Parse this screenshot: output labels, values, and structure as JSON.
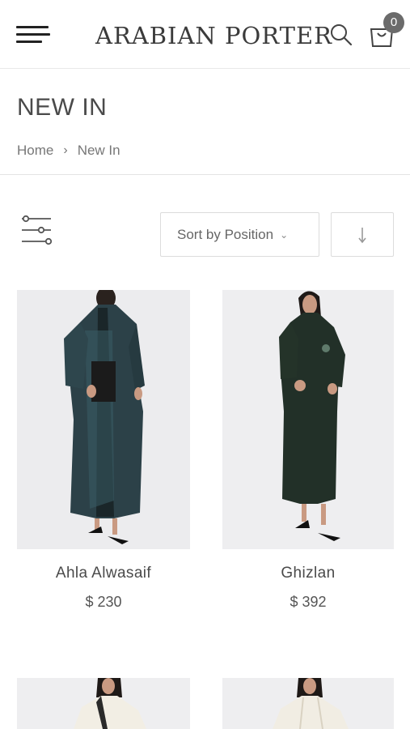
{
  "header": {
    "logo": "ARABIAN PORTER",
    "cart_count": "0"
  },
  "page": {
    "title": "NEW IN",
    "breadcrumb": [
      "Home",
      "New In"
    ],
    "breadcrumb_separator": "›"
  },
  "toolbar": {
    "sort_label": "Sort by Position",
    "sort_direction_icon": "arrow-down-icon",
    "filter_icon": "filter-sliders-icon"
  },
  "products": [
    {
      "name": "Ahla Alwasaif",
      "price": "$ 230",
      "image": "dark teal abaya with embroidery"
    },
    {
      "name": "Ghizlan",
      "price": "$ 392",
      "image": "dark green abaya"
    },
    {
      "name": "",
      "price": "",
      "image": "cream abaya"
    },
    {
      "name": "",
      "price": "",
      "image": "cream abaya"
    }
  ],
  "colors": {
    "text": "#333333",
    "muted": "#777777",
    "badge": "#6b6b6b",
    "border": "#dcdcdc"
  }
}
